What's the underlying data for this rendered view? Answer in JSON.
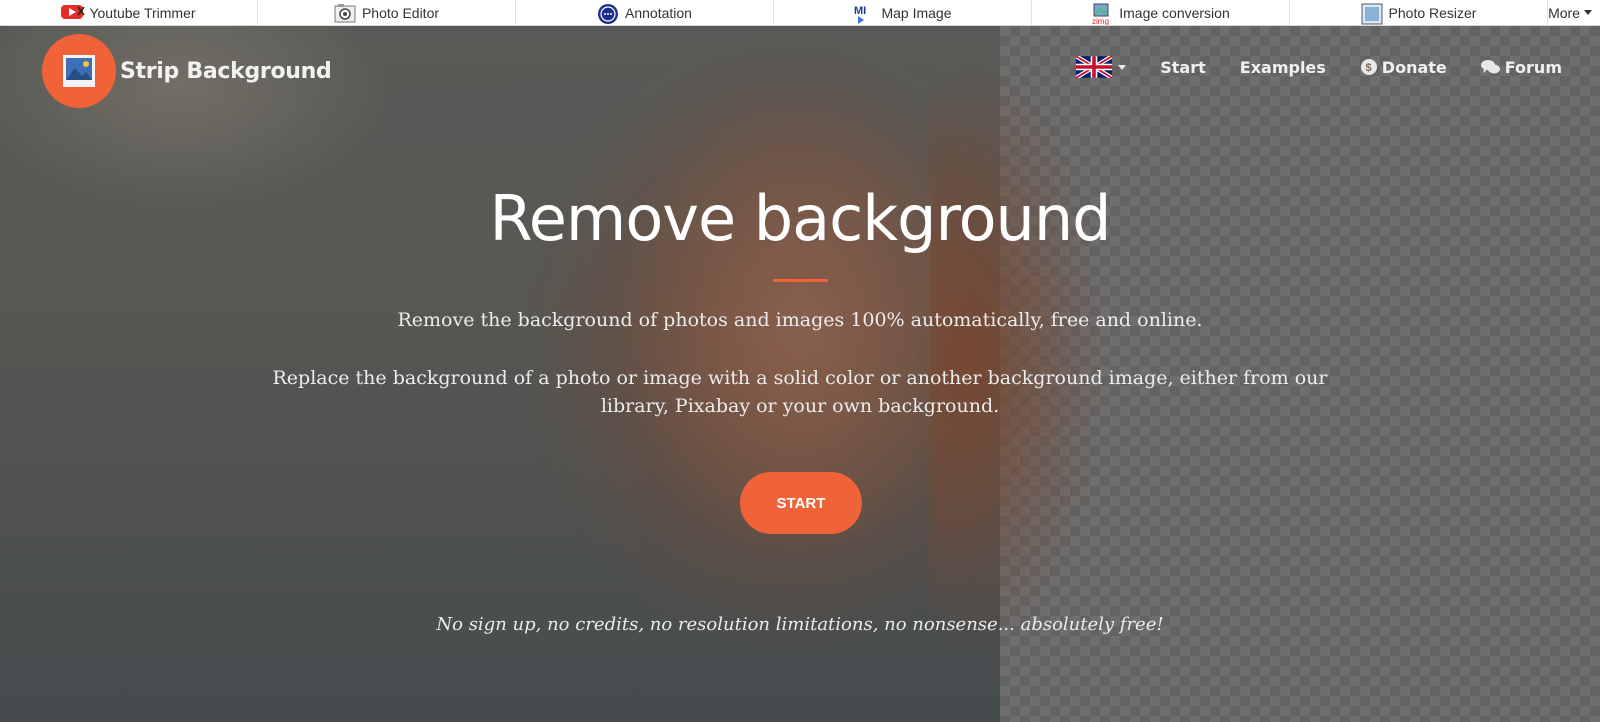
{
  "tools_bar": {
    "items": [
      {
        "label": "Youtube Trimmer",
        "icon": "youtube-trimmer-icon"
      },
      {
        "label": "Photo Editor",
        "icon": "camera-icon"
      },
      {
        "label": "Annotation",
        "icon": "annotation-icon"
      },
      {
        "label": "Map Image",
        "icon": "map-image-icon"
      },
      {
        "label": "Image conversion",
        "icon": "image-conversion-icon"
      },
      {
        "label": "Photo Resizer",
        "icon": "photo-resizer-icon"
      }
    ],
    "more_label": "More"
  },
  "header": {
    "brand_name": "Strip Background",
    "brand_icon": "picture-icon",
    "language_flag": "uk-flag-icon",
    "nav": {
      "start": "Start",
      "examples": "Examples",
      "donate": "Donate",
      "forum": "Forum"
    }
  },
  "hero": {
    "title": "Remove background",
    "lead1": "Remove the background of photos and images 100% automatically, free and online.",
    "lead2": "Replace the background of a photo or image with a solid color or another background image, either from our library, Pixabay or your own background.",
    "start_button": "START",
    "tagline": "No sign up, no credits, no resolution limitations, no nonsense... absolutely free!"
  },
  "colors": {
    "accent": "#f06238",
    "text_light": "#f0f0f0"
  }
}
